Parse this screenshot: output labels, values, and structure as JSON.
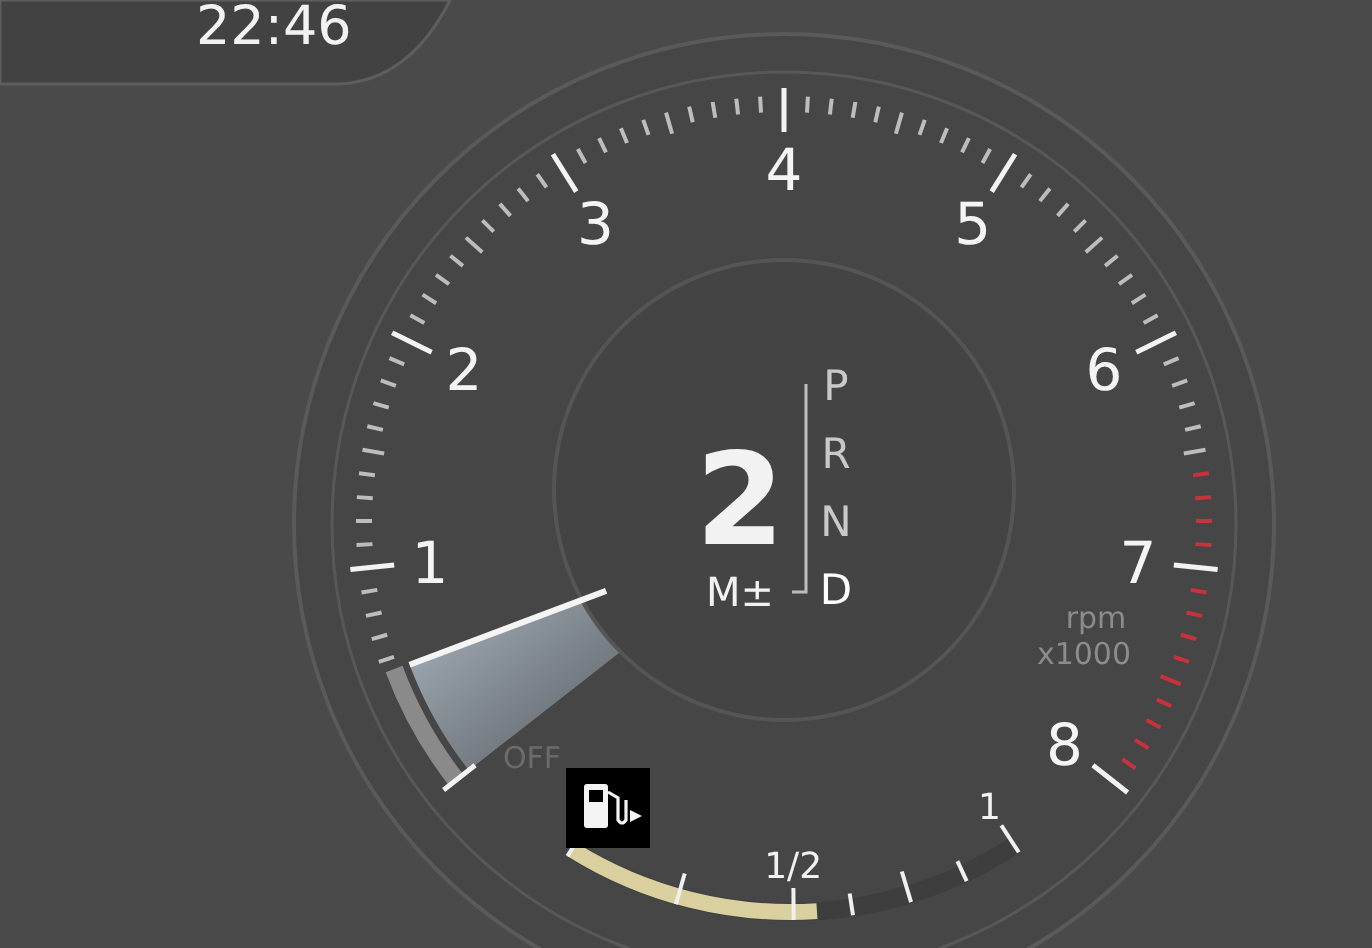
{
  "clock": {
    "time": "22:46"
  },
  "tachometer": {
    "scale_labels": [
      "1",
      "2",
      "3",
      "4",
      "5",
      "6",
      "7",
      "8"
    ],
    "off_label": "OFF",
    "unit": "rpm",
    "multiplier": "x1000",
    "needle": {
      "level": 0.068
    }
  },
  "gear": {
    "number": "2",
    "mode": "M±",
    "positions": [
      {
        "label": "P",
        "selected": false
      },
      {
        "label": "R",
        "selected": false
      },
      {
        "label": "N",
        "selected": false
      },
      {
        "label": "D",
        "selected": true
      }
    ]
  },
  "fuel_gauge": {
    "level": 0.55,
    "labels": [
      "1/2",
      "1"
    ]
  }
}
